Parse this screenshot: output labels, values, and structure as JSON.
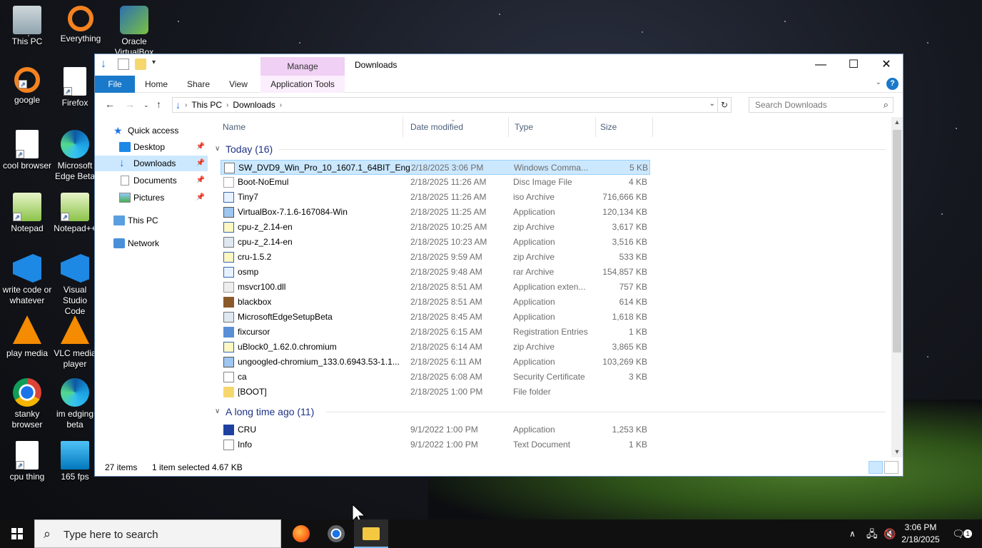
{
  "desktop": {
    "icons": [
      {
        "label": "This PC"
      },
      {
        "label": "Everything"
      },
      {
        "label": "Oracle VirtualBox"
      },
      {
        "label": "google"
      },
      {
        "label": "Firefox"
      },
      {
        "label": "cool browser"
      },
      {
        "label": "Microsoft Edge Beta"
      },
      {
        "label": "Notepad"
      },
      {
        "label": "Notepad++"
      },
      {
        "label": "write code or whatever"
      },
      {
        "label": "Visual Studio Code"
      },
      {
        "label": "play media"
      },
      {
        "label": "VLC media player"
      },
      {
        "label": "stanky browser"
      },
      {
        "label": "im edging beta"
      },
      {
        "label": "cpu thing"
      },
      {
        "label": "165 fps"
      }
    ]
  },
  "window": {
    "title": "Downloads",
    "manage_tab": "Manage",
    "controls": {
      "minimize": "—",
      "maximize": "☐",
      "close": "✕"
    },
    "ribbon_tabs": {
      "file": "File",
      "home": "Home",
      "share": "Share",
      "view": "View",
      "app_tools": "Application Tools"
    },
    "help": "?",
    "address": {
      "this_pc": "This PC",
      "downloads": "Downloads"
    },
    "search_placeholder": "Search Downloads",
    "nav": {
      "quick_access": "Quick access",
      "desktop": "Desktop",
      "downloads": "Downloads",
      "documents": "Documents",
      "pictures": "Pictures",
      "this_pc": "This PC",
      "network": "Network"
    },
    "columns": {
      "name": "Name",
      "date": "Date modified",
      "type": "Type",
      "size": "Size"
    },
    "groups": {
      "today": "Today (16)",
      "long_ago": "A long time ago (11)"
    },
    "files_today": [
      {
        "name": "SW_DVD9_Win_Pro_10_1607.1_64BIT_Eng...",
        "date": "2/18/2025 3:06 PM",
        "type": "Windows Comma...",
        "size": "5 KB"
      },
      {
        "name": "Boot-NoEmul",
        "date": "2/18/2025 11:26 AM",
        "type": "Disc Image File",
        "size": "4 KB"
      },
      {
        "name": "Tiny7",
        "date": "2/18/2025 11:26 AM",
        "type": "iso Archive",
        "size": "716,666 KB"
      },
      {
        "name": "VirtualBox-7.1.6-167084-Win",
        "date": "2/18/2025 11:25 AM",
        "type": "Application",
        "size": "120,134 KB"
      },
      {
        "name": "cpu-z_2.14-en",
        "date": "2/18/2025 10:25 AM",
        "type": "zip Archive",
        "size": "3,617 KB"
      },
      {
        "name": "cpu-z_2.14-en",
        "date": "2/18/2025 10:23 AM",
        "type": "Application",
        "size": "3,516 KB"
      },
      {
        "name": "cru-1.5.2",
        "date": "2/18/2025 9:59 AM",
        "type": "zip Archive",
        "size": "533 KB"
      },
      {
        "name": "osmp",
        "date": "2/18/2025 9:48 AM",
        "type": "rar Archive",
        "size": "154,857 KB"
      },
      {
        "name": "msvcr100.dll",
        "date": "2/18/2025 8:51 AM",
        "type": "Application exten...",
        "size": "757 KB"
      },
      {
        "name": "blackbox",
        "date": "2/18/2025 8:51 AM",
        "type": "Application",
        "size": "614 KB"
      },
      {
        "name": "MicrosoftEdgeSetupBeta",
        "date": "2/18/2025 8:45 AM",
        "type": "Application",
        "size": "1,618 KB"
      },
      {
        "name": "fixcursor",
        "date": "2/18/2025 6:15 AM",
        "type": "Registration Entries",
        "size": "1 KB"
      },
      {
        "name": "uBlock0_1.62.0.chromium",
        "date": "2/18/2025 6:14 AM",
        "type": "zip Archive",
        "size": "3,865 KB"
      },
      {
        "name": "ungoogled-chromium_133.0.6943.53-1.1...",
        "date": "2/18/2025 6:11 AM",
        "type": "Application",
        "size": "103,269 KB"
      },
      {
        "name": "ca",
        "date": "2/18/2025 6:08 AM",
        "type": "Security Certificate",
        "size": "3 KB"
      },
      {
        "name": "[BOOT]",
        "date": "2/18/2025 1:00 PM",
        "type": "File folder",
        "size": ""
      }
    ],
    "files_old": [
      {
        "name": "CRU",
        "date": "9/1/2022 1:00 PM",
        "type": "Application",
        "size": "1,253 KB"
      },
      {
        "name": "Info",
        "date": "9/1/2022 1:00 PM",
        "type": "Text Document",
        "size": "1 KB"
      }
    ],
    "status": {
      "count": "27 items",
      "selected": "1 item selected  4.67 KB"
    }
  },
  "taskbar": {
    "search_placeholder": "Type here to search",
    "time": "3:06 PM",
    "date": "2/18/2025",
    "notification_count": "1"
  }
}
